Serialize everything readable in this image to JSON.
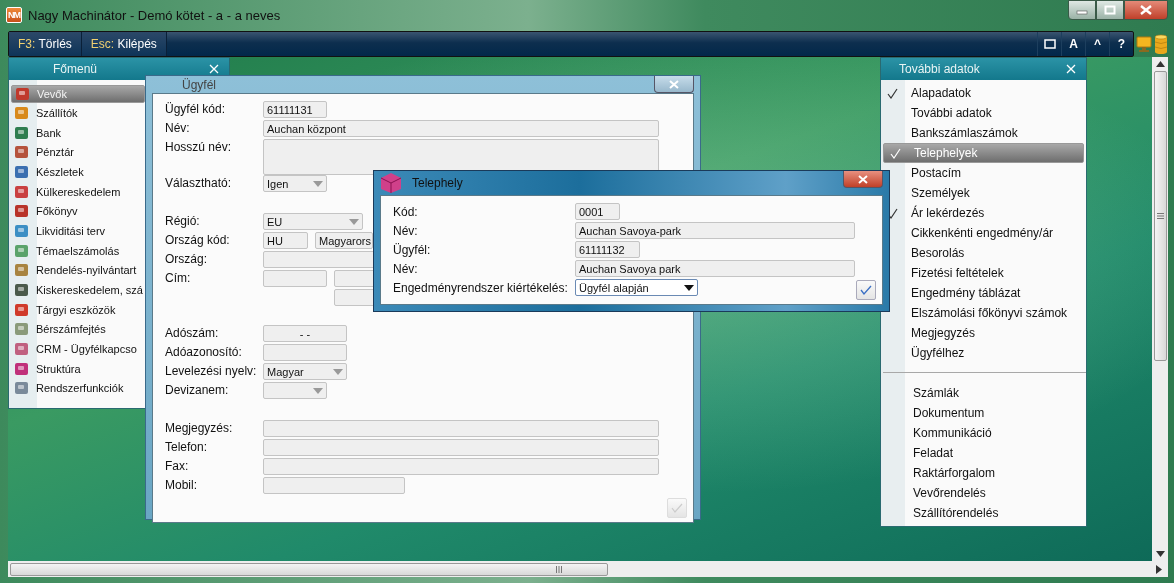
{
  "window": {
    "title": "Nagy Machinátor - Demó kötet - a - a neves",
    "logo": "NM"
  },
  "toolbar": {
    "commands": [
      {
        "key": "F3:",
        "label": "Törlés"
      },
      {
        "key": "Esc:",
        "label": "Kilépés"
      }
    ],
    "buttons": [
      {
        "kind": "window"
      },
      {
        "kind": "text",
        "label": "A"
      },
      {
        "kind": "text",
        "label": "^"
      },
      {
        "kind": "text",
        "label": "?"
      }
    ]
  },
  "main_menu": {
    "title": "Főmenü",
    "items": [
      {
        "label": "Vevők",
        "selected": true
      },
      {
        "label": "Szállítók",
        "selected": false
      },
      {
        "label": "Bank",
        "selected": false
      },
      {
        "label": "Pénztár",
        "selected": false
      },
      {
        "label": "Készletek",
        "selected": false
      },
      {
        "label": "Külkereskedelem",
        "selected": false
      },
      {
        "label": "Főkönyv",
        "selected": false
      },
      {
        "label": "Likviditási terv",
        "selected": false
      },
      {
        "label": "Témaelszámolás",
        "selected": false
      },
      {
        "label": "Rendelés-nyilvántart",
        "selected": false
      },
      {
        "label": "Kiskereskedelem, szá",
        "selected": false
      },
      {
        "label": "Tárgyi eszközök",
        "selected": false
      },
      {
        "label": "Bérszámfejtés",
        "selected": false
      },
      {
        "label": "CRM - Ügyfélkapcso",
        "selected": false
      },
      {
        "label": "Struktúra",
        "selected": false
      },
      {
        "label": "Rendszerfunkciók",
        "selected": false
      }
    ]
  },
  "customer_dialog": {
    "title": "Ügyfél",
    "sections": [
      [
        {
          "label": "Ügyfél kód:",
          "fields": [
            {
              "kind": "text",
              "value": "61111131"
            }
          ]
        },
        {
          "label": "Név:",
          "fields": [
            {
              "kind": "text",
              "value": "Auchan központ"
            }
          ]
        },
        {
          "label": "Hosszú név:",
          "fields": [
            {
              "kind": "area"
            }
          ]
        },
        {
          "label": "Választható:",
          "fields": [
            {
              "kind": "dropdown",
              "value": "Igen"
            }
          ]
        }
      ],
      [
        {
          "label": "Régió:",
          "fields": [
            {
              "kind": "dropdown",
              "value": "EU"
            }
          ]
        },
        {
          "label": "Ország kód:",
          "fields": [
            {
              "kind": "text",
              "value": "HU"
            },
            {
              "kind": "text",
              "value": "Magyarors"
            }
          ]
        },
        {
          "label": "Ország:",
          "fields": [
            {
              "kind": "text"
            }
          ]
        },
        {
          "label": "Cím:",
          "fields": [
            {
              "kind": "text"
            },
            {
              "kind": "text"
            },
            {
              "kind": "text"
            }
          ]
        }
      ],
      [
        {
          "label": "Adószám:",
          "fields": [
            {
              "kind": "text",
              "value": "- -"
            }
          ]
        },
        {
          "label": "Adóazonosító:",
          "fields": [
            {
              "kind": "text"
            }
          ]
        },
        {
          "label": "Levelezési nyelv:",
          "fields": [
            {
              "kind": "dropdown",
              "value": "Magyar"
            }
          ]
        },
        {
          "label": "Devizanem:",
          "fields": [
            {
              "kind": "dropdown"
            }
          ]
        }
      ],
      [
        {
          "label": "Megjegyzés:",
          "fields": [
            {
              "kind": "text"
            }
          ]
        },
        {
          "label": "Telefon:",
          "fields": [
            {
              "kind": "text"
            }
          ]
        },
        {
          "label": "Fax:",
          "fields": [
            {
              "kind": "text"
            }
          ]
        },
        {
          "label": "Mobil:",
          "fields": [
            {
              "kind": "text"
            }
          ]
        }
      ]
    ]
  },
  "site_dialog": {
    "title": "Telephely",
    "rows": [
      {
        "label": "Kód:",
        "field": {
          "kind": "text",
          "value": "0001"
        }
      },
      {
        "label": "Név:",
        "field": {
          "kind": "text",
          "value": "Auchan Savoya-park"
        }
      },
      {
        "label": "Ügyfél:",
        "field": {
          "kind": "text",
          "value": "61111132"
        }
      },
      {
        "label": "Név:",
        "field": {
          "kind": "text",
          "value": "Auchan Savoya park"
        }
      },
      {
        "label": "Engedményrendszer kiértékelés:",
        "field": {
          "kind": "dropdown",
          "value": "Ügyfél alapján"
        }
      }
    ]
  },
  "more_data": {
    "title": "További adatok",
    "groups": [
      [
        {
          "label": "Alapadatok",
          "checked": true,
          "selected": false
        },
        {
          "label": "További adatok",
          "checked": false,
          "selected": false
        },
        {
          "label": "Bankszámlaszámok",
          "checked": false,
          "selected": false
        },
        {
          "label": "Telephelyek",
          "checked": true,
          "selected": true
        },
        {
          "label": "Postacím",
          "checked": false,
          "selected": false
        },
        {
          "label": "Személyek",
          "checked": false,
          "selected": false
        },
        {
          "label": "Ár lekérdezés",
          "checked": true,
          "selected": false
        },
        {
          "label": "Cikkenkénti engedmény/ár",
          "checked": false,
          "selected": false
        },
        {
          "label": "Besorolás",
          "checked": false,
          "selected": false
        },
        {
          "label": "Fizetési feltételek",
          "checked": false,
          "selected": false
        },
        {
          "label": "Engedmény táblázat",
          "checked": false,
          "selected": false
        },
        {
          "label": "Elszámolási főkönyvi számok",
          "checked": false,
          "selected": false
        },
        {
          "label": "Megjegyzés",
          "checked": false,
          "selected": false
        },
        {
          "label": "Ügyfélhez",
          "checked": false,
          "selected": false
        }
      ],
      [
        {
          "label": "Számlák",
          "checked": false,
          "selected": false
        },
        {
          "label": "Dokumentum",
          "checked": false,
          "selected": false
        },
        {
          "label": "Kommunikáció",
          "checked": false,
          "selected": false
        },
        {
          "label": "Feladat",
          "checked": false,
          "selected": false
        },
        {
          "label": "Raktárforgalom",
          "checked": false,
          "selected": false
        },
        {
          "label": "Vevőrendelés",
          "checked": false,
          "selected": false
        },
        {
          "label": "Szállítórendelés",
          "checked": false,
          "selected": false
        }
      ]
    ]
  }
}
